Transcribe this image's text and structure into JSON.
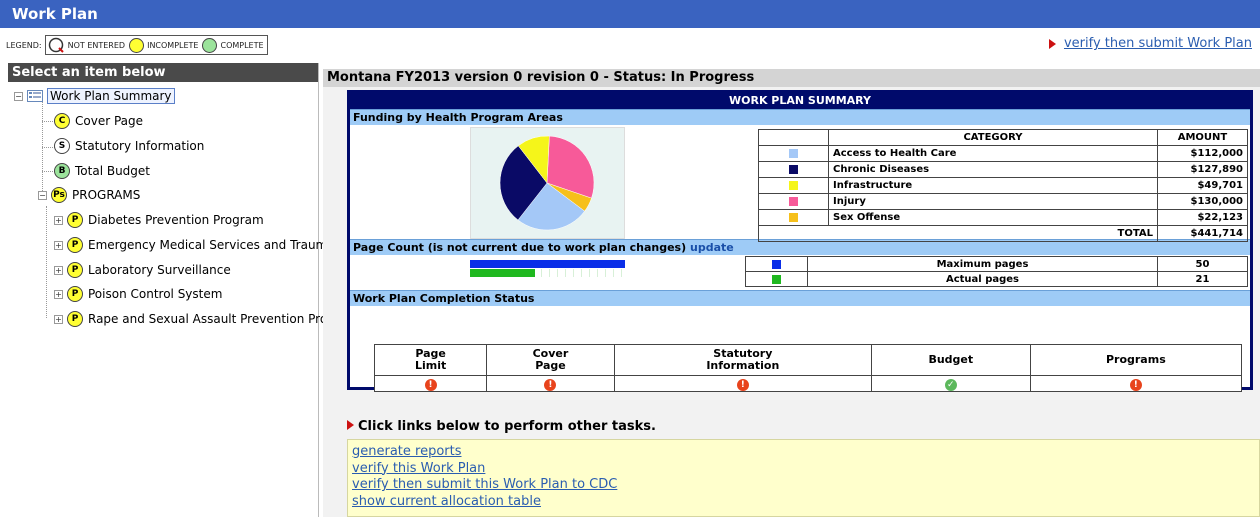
{
  "window": {
    "title": "Work Plan"
  },
  "legend": {
    "label": "LEGEND:",
    "items": [
      {
        "label": "NOT ENTERED",
        "icon": "not-entered-icon",
        "color": "#ffffff"
      },
      {
        "label": "INCOMPLETE",
        "icon": "incomplete-icon",
        "color": "#ffff33"
      },
      {
        "label": "COMPLETE",
        "icon": "complete-icon",
        "color": "#9be39b"
      }
    ]
  },
  "top_link": "verify then submit Work Plan",
  "sidebar": {
    "header": "Select an item below",
    "root": "Work Plan Summary",
    "items": [
      {
        "badge": "C",
        "label": "Cover Page",
        "status": "incomplete"
      },
      {
        "badge": "S",
        "label": "Statutory Information",
        "status": "not-entered"
      },
      {
        "badge": "B",
        "label": "Total Budget",
        "status": "complete"
      },
      {
        "badge": "Ps",
        "label": "PROGRAMS",
        "status": "incomplete"
      }
    ],
    "programs": [
      {
        "badge": "P",
        "label": "Diabetes Prevention Program"
      },
      {
        "badge": "P",
        "label": "Emergency Medical Services and Trauma"
      },
      {
        "badge": "P",
        "label": "Laboratory Surveillance"
      },
      {
        "badge": "P",
        "label": "Poison Control System"
      },
      {
        "badge": "P",
        "label": "Rape and Sexual Assault Prevention Progr"
      }
    ]
  },
  "main": {
    "header": "Montana FY2013 version 0 revision 0 - Status: In Progress",
    "summary_title": "WORK PLAN SUMMARY",
    "funding_section": "Funding by Health Program Areas",
    "category_header": "CATEGORY",
    "amount_header": "AMOUNT",
    "categories": [
      {
        "name": "Access to Health Care",
        "amount": "$112,000",
        "color": "#a4c8f7",
        "value": 112000
      },
      {
        "name": "Chronic Diseases",
        "amount": "$127,890",
        "color": "#0a0a66",
        "value": 127890
      },
      {
        "name": "Infrastructure",
        "amount": "$49,701",
        "color": "#f5f51a",
        "value": 49701
      },
      {
        "name": "Injury",
        "amount": "$130,000",
        "color": "#f75a99",
        "value": 130000
      },
      {
        "name": "Sex Offense",
        "amount": "$22,123",
        "color": "#f6c01b",
        "value": 22123
      }
    ],
    "total_label": "TOTAL",
    "total_amount": "$441,714",
    "page_count_section": "Page Count (is not current due to work plan changes)",
    "page_count_link": "update",
    "max_pages_label": "Maximum pages",
    "max_pages": "50",
    "max_pages_color": "#0a2ee8",
    "actual_pages_label": "Actual pages",
    "actual_pages": "21",
    "actual_pages_color": "#1fb81f",
    "actual_fraction": 0.42,
    "completion_section": "Work Plan Completion Status",
    "completion_columns": [
      {
        "line1": "Page",
        "line2": "Limit",
        "status": "incomplete"
      },
      {
        "line1": "Cover",
        "line2": "Page",
        "status": "incomplete"
      },
      {
        "line1": "Statutory",
        "line2": "Information",
        "status": "incomplete"
      },
      {
        "line1": "Budget",
        "line2": "",
        "status": "complete"
      },
      {
        "line1": "Programs",
        "line2": "",
        "status": "incomplete"
      }
    ],
    "links_header": "Click links below to perform other tasks.",
    "links": [
      "generate reports",
      "verify this Work Plan",
      "verify then submit this Work Plan to CDC",
      "show current allocation table"
    ]
  },
  "chart_data": {
    "type": "pie",
    "categories": [
      "Access to Health Care",
      "Chronic Diseases",
      "Infrastructure",
      "Injury",
      "Sex Offense"
    ],
    "values": [
      112000,
      127890,
      49701,
      130000,
      22123
    ],
    "colors": [
      "#a4c8f7",
      "#0a0a66",
      "#f5f51a",
      "#f75a99",
      "#f6c01b"
    ]
  }
}
